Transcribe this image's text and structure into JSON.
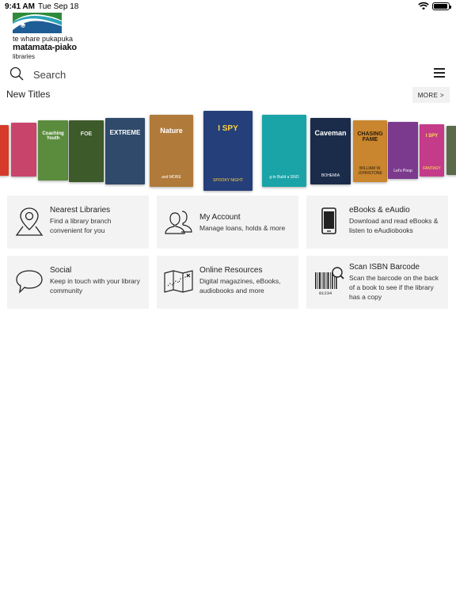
{
  "status_bar": {
    "time": "9:41 AM",
    "date": "Tue Sep 18"
  },
  "logo": {
    "line1": "te whare pukapuka",
    "line2": "matamata-piako",
    "line3": "libraries",
    "colors": {
      "green": "#2e8b3a",
      "blue": "#1f5d96",
      "teal": "#2aa2b8"
    }
  },
  "search": {
    "placeholder": "Search"
  },
  "new_titles": {
    "title": "New Titles",
    "more_label": "MORE >",
    "books": [
      {
        "label": "",
        "sub": "",
        "bg": "#d63a2a",
        "fg": "#fff"
      },
      {
        "label": "",
        "sub": "",
        "bg": "#c8446b",
        "fg": "#fff"
      },
      {
        "label": "Coaching Youth",
        "sub": "",
        "bg": "#5b8c3e",
        "fg": "#fff"
      },
      {
        "label": "FOE",
        "sub": "",
        "bg": "#3d5a2a",
        "fg": "#e8e8e8"
      },
      {
        "label": "EXTREME",
        "sub": "",
        "bg": "#2f4a6a",
        "fg": "#fff"
      },
      {
        "label": "Nature",
        "sub": "and MORE",
        "bg": "#b07a3a",
        "fg": "#fff"
      },
      {
        "label": "I SPY",
        "sub": "SPOOKY NIGHT",
        "bg": "#243f7a",
        "fg": "#ffd23a"
      },
      {
        "label": "",
        "sub": "g to Build a SNO",
        "bg": "#1aa4a8",
        "fg": "#fff"
      },
      {
        "label": "Caveman",
        "sub": "BOHEMIA",
        "bg": "#1b2b4a",
        "fg": "#fff"
      },
      {
        "label": "CHASING FAME",
        "sub": "WILLIAM W. JOHNSTONE",
        "bg": "#c9862e",
        "fg": "#2a1a0a"
      },
      {
        "label": "",
        "sub": "Let's Poop",
        "bg": "#7b3a8e",
        "fg": "#fff"
      },
      {
        "label": "I SPY",
        "sub": "FANTASY",
        "bg": "#c43b8a",
        "fg": "#ffe44a"
      },
      {
        "label": "",
        "sub": "",
        "bg": "#5a6b4a",
        "fg": "#fff"
      }
    ]
  },
  "tiles": [
    {
      "icon": "map-pin-icon",
      "title": "Nearest Libraries",
      "desc": "Find a library branch convenient for you"
    },
    {
      "icon": "people-icon",
      "title": "My Account",
      "desc": "Manage loans, holds & more"
    },
    {
      "icon": "tablet-icon",
      "title": "eBooks & eAudio",
      "desc": "Download and read eBooks & listen to eAudiobooks"
    },
    {
      "icon": "speech-bubble-icon",
      "title": "Social",
      "desc": "Keep in touch with your library community"
    },
    {
      "icon": "map-icon",
      "title": "Online Resources",
      "desc": "Digital magazines, eBooks, audiobooks and more"
    },
    {
      "icon": "barcode-icon",
      "title": "Scan ISBN Barcode",
      "desc": "Scan the barcode on the back of a book to see if the library has a copy"
    }
  ],
  "barcode_digits": "01234"
}
